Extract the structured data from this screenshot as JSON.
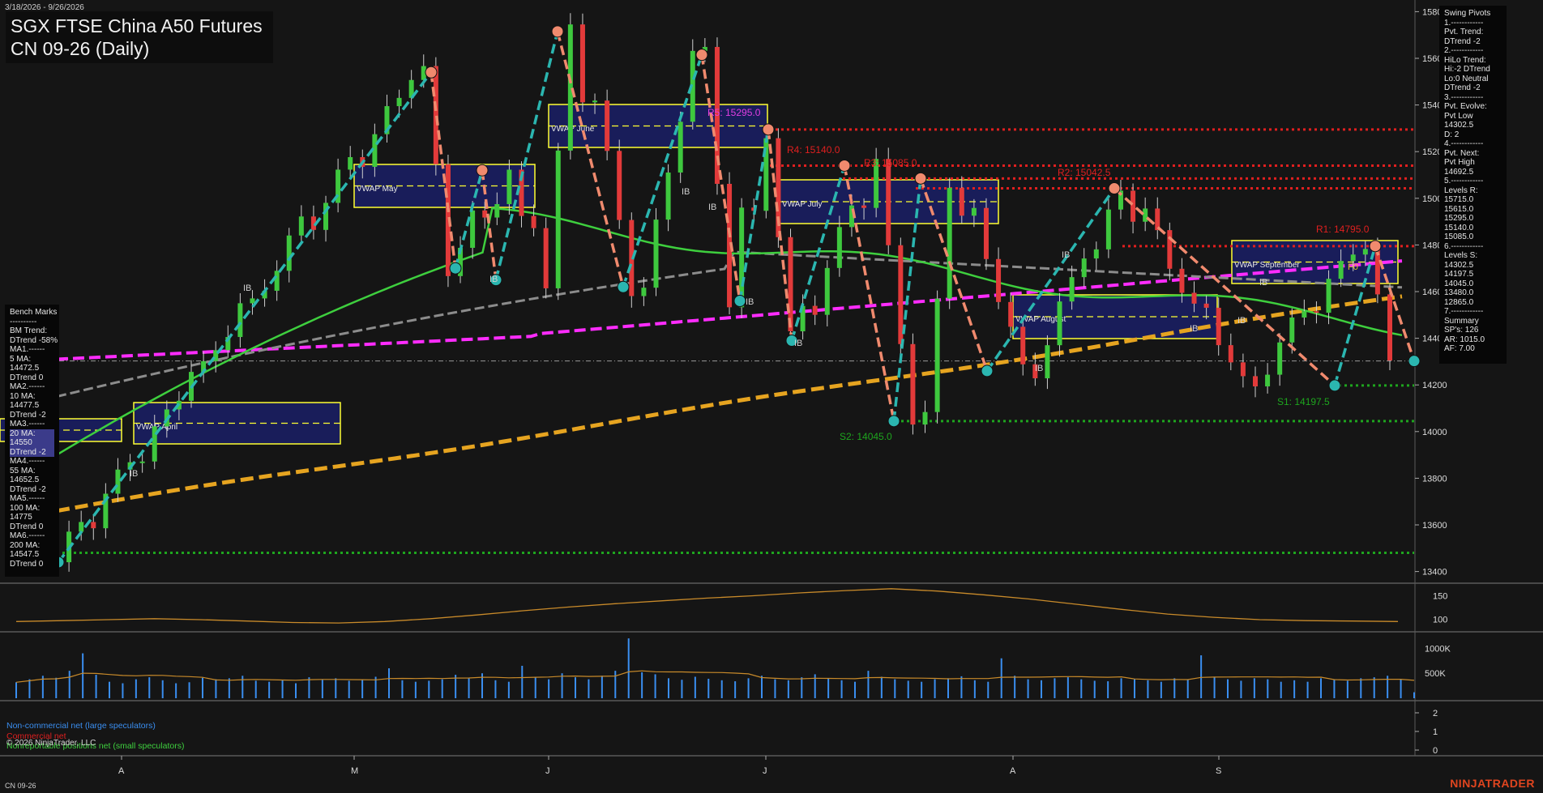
{
  "header": {
    "date_range": "3/18/2026 - 9/26/2026",
    "title_line1": "SGX FTSE China A50 Futures",
    "title_line2": "CN 09-26 (Daily)"
  },
  "footer": {
    "symbol": "CN 09-26",
    "copyright": "© 2026 NinjaTrader, LLC",
    "brand": "NINJATRADER"
  },
  "cot_legend": {
    "noncommercial": "Non-commercial net (large speculators)",
    "commercial": "Commercial net",
    "nonreportable": "Nonreportable positions net (small speculators)"
  },
  "swing_pivots": [
    "Swing Pivots",
    "1.------------",
    "Pvt. Trend:",
    "DTrend -2",
    "2.------------",
    "HiLo Trend:",
    "Hi:-2 DTrend",
    "Lo:0 Neutral",
    "DTrend -2",
    "3.------------",
    "Pvt. Evolve:",
    "Pvt Low",
    "14302.5",
    "D: 2",
    "4.------------",
    "Pvt. Next:",
    "Pvt High",
    "14692.5",
    "5.------------",
    "Levels R:",
    "15715.0",
    "15615.0",
    "15295.0",
    "15140.0",
    "15085.0",
    "6.------------",
    "Levels S:",
    "14302.5",
    "14197.5",
    "14045.0",
    "13480.0",
    "12865.0",
    "7.------------",
    "Summary",
    "SP's: 126",
    "AR: 1015.0",
    "AF: 7.00"
  ],
  "bench_marks": [
    "Bench Marks",
    "----------",
    "BM Trend:",
    "DTrend -58%",
    "MA1.------",
    "5 MA:",
    "14472.5",
    "DTrend 0",
    "MA2.------",
    "10 MA:",
    "14477.5",
    "DTrend -2",
    "MA3.------",
    "20 MA:",
    "14550",
    "DTrend -2",
    "MA4.------",
    "55 MA:",
    "14652.5",
    "DTrend -2",
    "MA5.------",
    "100 MA:",
    "14775",
    "DTrend 0",
    "MA6.------",
    "200 MA:",
    "14547.5",
    "DTrend 0"
  ],
  "level_labels": {
    "r4": "R4: 15140.0",
    "r3": "R3: 15085.0",
    "r2": "R2: 15042.5",
    "r1": "R1: 14795.0",
    "r5": "R5: 15295.0",
    "s1": "S1: 14197.5",
    "s2": "S2: 14045.0"
  },
  "vwap_box_labels": [
    "VWAP April",
    "VWAP May",
    "VWAP June",
    "VWAP July",
    "VWAP August",
    "VWAP September"
  ],
  "ib_label": "IB",
  "fo_label": "F0",
  "colors": {
    "background": "#151515",
    "up_candle": "#3ec83e",
    "down_candle": "#e23a3a",
    "swing_up": "#2bb6b0",
    "swing_down": "#f08a6e",
    "ma_magenta": "#ff2cff",
    "ma_orange": "#e6a420",
    "ma_green": "#3ecf3e",
    "ma_gray": "#8c8c8c",
    "resistance": "#e01f1f",
    "support": "#1ea51e",
    "vwap_box": "#ffff33",
    "volume_bar": "#3a8ef0",
    "brand": "#e0451f"
  },
  "chart_data": [
    {
      "type": "line",
      "title": "SGX FTSE China A50 Futures CN 09-26 (Daily)",
      "x_ticks": [
        "A",
        "M",
        "J",
        "J",
        "A",
        "S"
      ],
      "ylim": [
        13350,
        15850
      ],
      "y_ticks": [
        13400,
        13600,
        13800,
        14000,
        14200,
        14400,
        14600,
        14800,
        15000,
        15200,
        15400,
        15600,
        15800
      ],
      "swing_pivots": [
        {
          "type": "low",
          "value": 13440
        },
        {
          "type": "high",
          "value": 15540
        },
        {
          "type": "low",
          "value": 14700
        },
        {
          "type": "high",
          "value": 15120
        },
        {
          "type": "low",
          "value": 14650
        },
        {
          "type": "high",
          "value": 15715
        },
        {
          "type": "low",
          "value": 14620
        },
        {
          "type": "high",
          "value": 15615
        },
        {
          "type": "low",
          "value": 14560
        },
        {
          "type": "high",
          "value": 15295
        },
        {
          "type": "low",
          "value": 14390
        },
        {
          "type": "high",
          "value": 15140
        },
        {
          "type": "low",
          "value": 14045
        },
        {
          "type": "high",
          "value": 15085
        },
        {
          "type": "low",
          "value": 14260
        },
        {
          "type": "high",
          "value": 15042.5
        },
        {
          "type": "low",
          "value": 14197.5
        },
        {
          "type": "high",
          "value": 14795
        },
        {
          "type": "low",
          "value": 14302.5
        }
      ],
      "moving_averages": [
        {
          "name": "5 MA",
          "last": 14472.5
        },
        {
          "name": "10 MA",
          "last": 14477.5
        },
        {
          "name": "20 MA",
          "last": 14550
        },
        {
          "name": "55 MA",
          "last": 14652.5
        },
        {
          "name": "100 MA",
          "last": 14775
        },
        {
          "name": "200 MA",
          "last": 14547.5
        }
      ],
      "resistance_levels": [
        15295.0,
        15140.0,
        15085.0,
        15042.5,
        14795.0
      ],
      "support_levels": [
        14197.5,
        14045.0,
        13480.0
      ]
    },
    {
      "type": "line",
      "title": "",
      "y_ticks": [
        100,
        150
      ],
      "values": [
        95,
        97,
        99,
        101,
        99,
        96,
        93,
        92,
        95,
        101,
        109,
        118,
        126,
        133,
        139,
        145,
        150,
        156,
        161,
        165,
        160,
        152,
        143,
        132,
        121,
        111,
        104,
        99,
        97,
        96,
        95
      ]
    },
    {
      "type": "bar",
      "title": "",
      "y_ticks": [
        "500K",
        "1000K"
      ],
      "values": [
        320,
        380,
        450,
        410,
        550,
        900,
        470,
        330,
        300,
        380,
        420,
        360,
        300,
        320,
        410,
        380,
        400,
        450,
        350,
        330,
        360,
        300,
        420,
        370,
        400,
        350,
        380,
        430,
        600,
        360,
        330,
        350,
        380,
        470,
        410,
        500,
        360,
        330,
        650,
        430,
        380,
        500,
        420,
        380,
        450,
        550,
        1200,
        520,
        480,
        400,
        370,
        430,
        390,
        360,
        340,
        400,
        450,
        380,
        360,
        420,
        480,
        390,
        360,
        330,
        550,
        430,
        380,
        350,
        330,
        380,
        400,
        440,
        360,
        330,
        800,
        450,
        380,
        360,
        400,
        420,
        380,
        350,
        340,
        400,
        380,
        360,
        330,
        400,
        380,
        860,
        430,
        380,
        350,
        400,
        380,
        330,
        360,
        330,
        400,
        380,
        350,
        400,
        420,
        450,
        380,
        120
      ]
    },
    {
      "type": "line",
      "title": "",
      "y_ticks": [
        0,
        1,
        2
      ]
    }
  ]
}
